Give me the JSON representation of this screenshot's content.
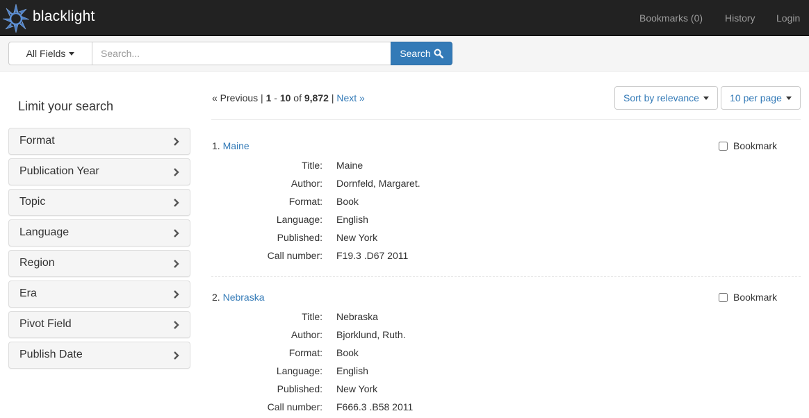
{
  "navbar": {
    "brand": "blacklight",
    "links": [
      {
        "label": "Bookmarks (0)"
      },
      {
        "label": "History"
      },
      {
        "label": "Login"
      }
    ]
  },
  "search": {
    "field_select": "All Fields",
    "placeholder": "Search...",
    "button_label": "Search"
  },
  "sidebar": {
    "heading": "Limit your search",
    "facets": [
      {
        "label": "Format"
      },
      {
        "label": "Publication Year"
      },
      {
        "label": "Topic"
      },
      {
        "label": "Language"
      },
      {
        "label": "Region"
      },
      {
        "label": "Era"
      },
      {
        "label": "Pivot Field"
      },
      {
        "label": "Publish Date"
      }
    ]
  },
  "results": {
    "pager": {
      "previous": "« Previous",
      "separator": "|",
      "range_start": "1",
      "range_dash": "-",
      "range_end": "10",
      "of": "of",
      "total": "9,872",
      "next": "Next »"
    },
    "sort_label": "Sort by relevance",
    "per_page_label": "10 per page",
    "bookmark_label": "Bookmark",
    "field_labels": {
      "title": "Title:",
      "author": "Author:",
      "format": "Format:",
      "language": "Language:",
      "published": "Published:",
      "call_number": "Call number:"
    },
    "documents": [
      {
        "index": "1.",
        "title_link": "Maine",
        "title": "Maine",
        "author": "Dornfeld, Margaret.",
        "format": "Book",
        "language": "English",
        "published": "New York",
        "call_number": "F19.3 .D67 2011"
      },
      {
        "index": "2.",
        "title_link": "Nebraska",
        "title": "Nebraska",
        "author": "Bjorklund, Ruth.",
        "format": "Book",
        "language": "English",
        "published": "New York",
        "call_number": "F666.3 .B58 2011"
      }
    ]
  },
  "colors": {
    "navbar_bg": "#222222",
    "link": "#337ab7",
    "primary_button": "#337ab7",
    "logo": "#5b8fd6"
  }
}
